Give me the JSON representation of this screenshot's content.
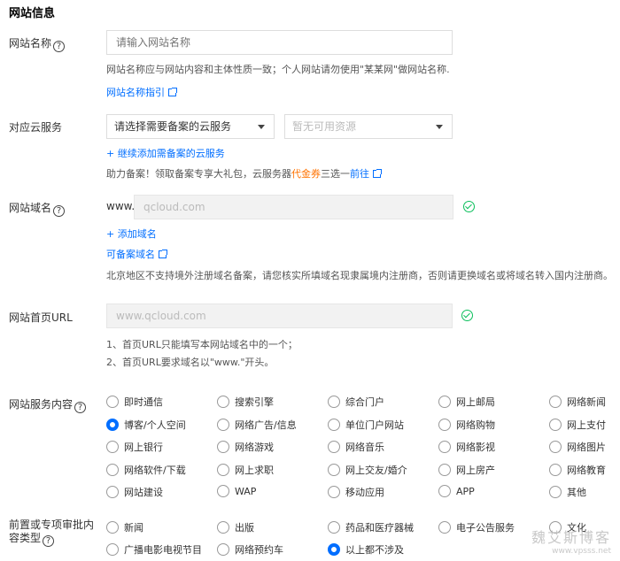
{
  "section_title": "网站信息",
  "site_name": {
    "label": "网站名称",
    "placeholder": "请输入网站名称",
    "hint": "网站名称应与网站内容和主体性质一致；个人网站请勿使用\"某某网\"做网站名称.",
    "guide_link": "网站名称指引"
  },
  "cloud_service": {
    "label": "对应云服务",
    "select1": "请选择需要备案的云服务",
    "select2": "暂无可用资源",
    "add_link": "+ 继续添加需备案的云服务",
    "promo_prefix": "助力备案！领取备案专享大礼包，云服务器",
    "promo_highlight": "代金券",
    "promo_mid": "三选一",
    "promo_link": "前往"
  },
  "domain": {
    "label": "网站域名",
    "prefix": "www.",
    "value": "qcloud.com",
    "add_link": "+ 添加域名",
    "registrable_link": "可备案域名",
    "note": "北京地区不支持境外注册域名备案，请您核实所填域名现隶属境内注册商，否则请更换域名或将域名转入国内注册商。"
  },
  "homepage": {
    "label": "网站首页URL",
    "value": "www.qcloud.com",
    "rule1": "1、首页URL只能填写本网站域名中的一个；",
    "rule2": "2、首页URL要求域名以\"www.\"开头。"
  },
  "service_content": {
    "label": "网站服务内容",
    "options": [
      "即时通信",
      "搜索引擎",
      "综合门户",
      "网上邮局",
      "网络新闻",
      "博客/个人空间",
      "网络广告/信息",
      "单位门户网站",
      "网络购物",
      "网上支付",
      "网上银行",
      "网络游戏",
      "网络音乐",
      "网络影视",
      "网络图片",
      "网络软件/下载",
      "网上求职",
      "网上交友/婚介",
      "网上房产",
      "网络教育",
      "网站建设",
      "WAP",
      "移动应用",
      "APP",
      "其他"
    ],
    "selected_index": 5
  },
  "approval_type": {
    "label_line1": "前置或专项审批内",
    "label_line2": "容类型",
    "options": [
      "新闻",
      "出版",
      "药品和医疗器械",
      "电子公告服务",
      "文化",
      "广播电影电视节目",
      "网络预约车",
      "以上都不涉及"
    ],
    "selected_index": 7
  },
  "icons": {
    "help": "question-circle-icon",
    "external": "external-link-icon",
    "valid": "check-circle-icon",
    "caret": "caret-down-icon"
  },
  "colors": {
    "link": "#006eff",
    "highlight": "#ff7200",
    "success": "#0abf5b"
  },
  "watermark": {
    "line1": "魏艾斯博客",
    "line2": "www.vpsss.net"
  }
}
